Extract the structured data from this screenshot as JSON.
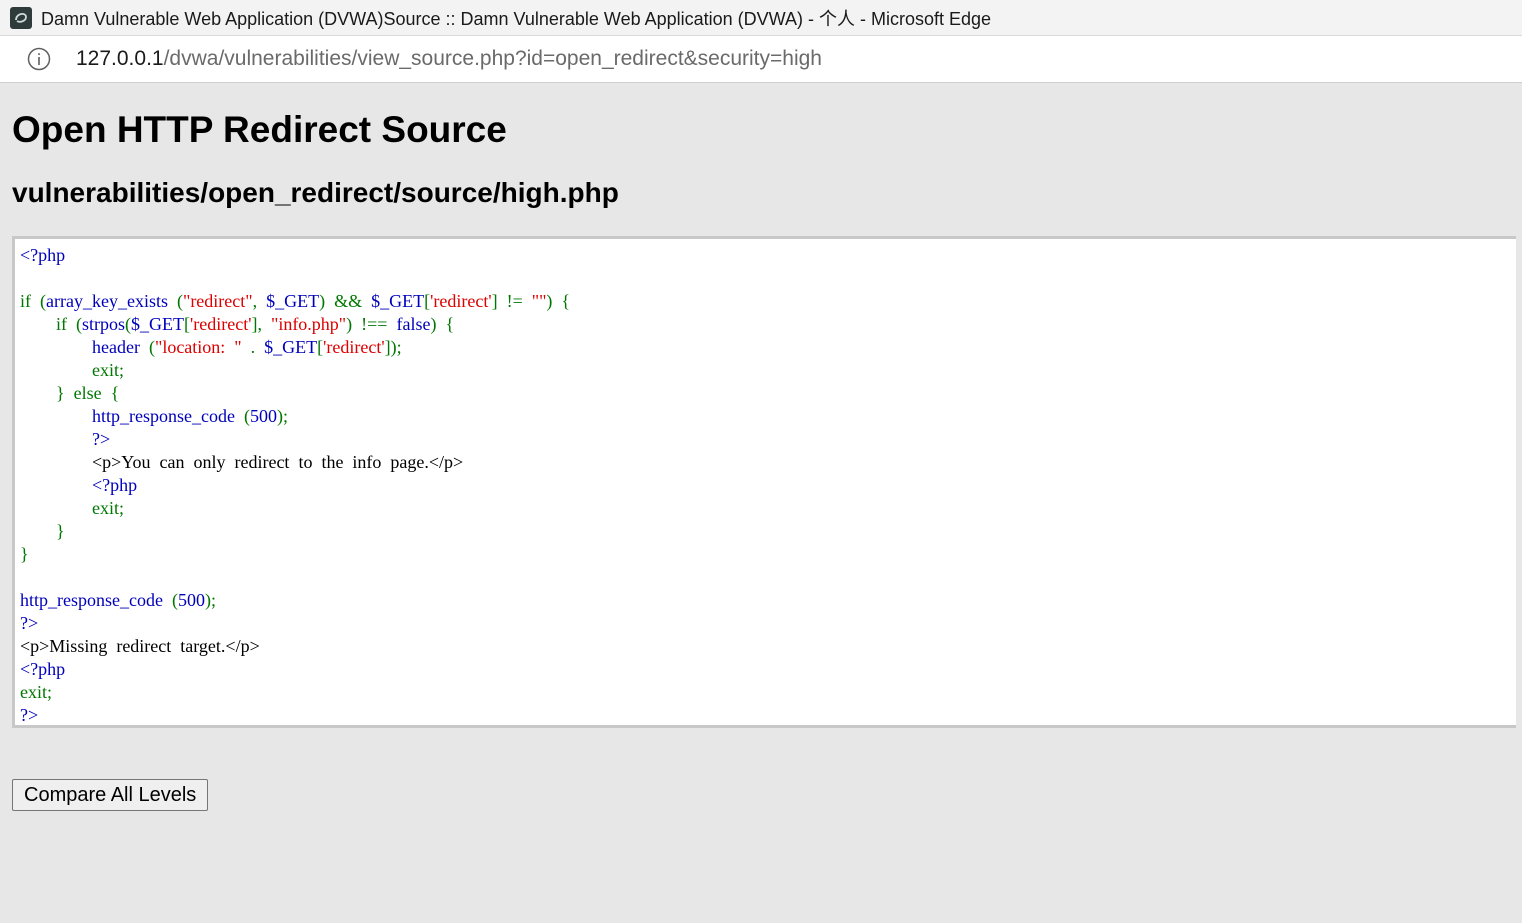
{
  "window": {
    "title": "Damn Vulnerable Web Application (DVWA)Source :: Damn Vulnerable Web Application (DVWA) - 个人 - Microsoft Edge",
    "app_icon": "dvwa-logo-icon"
  },
  "address_bar": {
    "icon": "info-icon",
    "url_host": "127.0.0.1",
    "url_path": "/dvwa/vulnerabilities/view_source.php?id=open_redirect&security=high"
  },
  "page": {
    "title": "Open HTTP Redirect Source",
    "file_path": "vulnerabilities/open_redirect/source/high.php",
    "compare_button": "Compare All Levels"
  },
  "code_lines": [
    [
      [
        "b",
        "<?php"
      ]
    ],
    [],
    [
      [
        "g",
        "if  ("
      ],
      [
        "b",
        "array_key_exists  "
      ],
      [
        "g",
        "("
      ],
      [
        "r",
        "\"redirect\""
      ],
      [
        "g",
        ",  "
      ],
      [
        "b",
        "$_GET"
      ],
      [
        "g",
        ")  &&  "
      ],
      [
        "b",
        "$_GET"
      ],
      [
        "g",
        "["
      ],
      [
        "r",
        "'redirect'"
      ],
      [
        "g",
        "]  !=  "
      ],
      [
        "r",
        "\"\""
      ],
      [
        "g",
        ")  {"
      ]
    ],
    [
      [
        "g",
        "        if  ("
      ],
      [
        "b",
        "strpos"
      ],
      [
        "g",
        "("
      ],
      [
        "b",
        "$_GET"
      ],
      [
        "g",
        "["
      ],
      [
        "r",
        "'redirect'"
      ],
      [
        "g",
        "],  "
      ],
      [
        "r",
        "\"info.php\""
      ],
      [
        "g",
        ")  !==  "
      ],
      [
        "b",
        "false"
      ],
      [
        "g",
        ")  {"
      ]
    ],
    [
      [
        "g",
        "                "
      ],
      [
        "b",
        "header  "
      ],
      [
        "g",
        "("
      ],
      [
        "r",
        "\"location:  \""
      ],
      [
        "g",
        "  .  "
      ],
      [
        "b",
        "$_GET"
      ],
      [
        "g",
        "["
      ],
      [
        "r",
        "'redirect'"
      ],
      [
        "g",
        "]);"
      ]
    ],
    [
      [
        "g",
        "                exit;"
      ]
    ],
    [
      [
        "g",
        "        }  else  {"
      ]
    ],
    [
      [
        "g",
        "                "
      ],
      [
        "b",
        "http_response_code  "
      ],
      [
        "g",
        "("
      ],
      [
        "b",
        "500"
      ],
      [
        "g",
        ");"
      ]
    ],
    [
      [
        "g",
        "                "
      ],
      [
        "b",
        "?>"
      ]
    ],
    [
      [
        "k",
        "                <p>You  can  only  redirect  to  the  info  page.</p>"
      ]
    ],
    [
      [
        "g",
        "                "
      ],
      [
        "b",
        "<?php"
      ]
    ],
    [
      [
        "g",
        "                exit;"
      ]
    ],
    [
      [
        "g",
        "        }"
      ]
    ],
    [
      [
        "g",
        "}"
      ]
    ],
    [],
    [
      [
        "b",
        "http_response_code  "
      ],
      [
        "g",
        "("
      ],
      [
        "b",
        "500"
      ],
      [
        "g",
        ");"
      ]
    ],
    [
      [
        "b",
        "?>"
      ]
    ],
    [
      [
        "k",
        "<p>Missing  redirect  target.</p>"
      ]
    ],
    [
      [
        "b",
        "<?php"
      ]
    ],
    [
      [
        "g",
        "exit;"
      ]
    ],
    [
      [
        "b",
        "?>"
      ]
    ]
  ],
  "colors": {
    "php_default": "#0000bb",
    "php_keyword": "#007700",
    "php_string": "#dd0000",
    "html": "#000000",
    "page_background": "#e7e7e7"
  }
}
